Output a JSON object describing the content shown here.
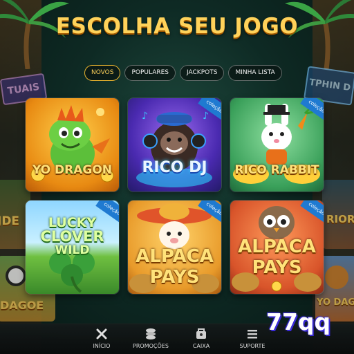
{
  "header": {
    "title": "ESCOLHA SEU JOGO"
  },
  "tabs": [
    {
      "label": "NOVOS",
      "active": true
    },
    {
      "label": "POPULARES",
      "active": false
    },
    {
      "label": "JACKPOTS",
      "active": false
    },
    {
      "label": "MINHA LISTA",
      "active": false
    }
  ],
  "games": [
    {
      "title": "YO DRAGON",
      "badge": ""
    },
    {
      "title": "RICO DJ",
      "badge": "coleção"
    },
    {
      "title": "RICO RABBIT",
      "badge": "coleção"
    },
    {
      "title_lines": [
        "LUCKY",
        "CLOVER",
        "WILD"
      ],
      "badge": "coleção"
    },
    {
      "title_lines": [
        "ALPACA",
        "PAYS"
      ],
      "badge": "coleção"
    },
    {
      "title_lines": [
        "ALPACA",
        "PAYS"
      ],
      "badge": "coleção"
    }
  ],
  "background": {
    "left_sign": "TUAIS",
    "right_sign": "TPHIN D",
    "left_side_text": "JDE",
    "right_side_text": "RIOR",
    "left_bottom_text": "DAGOE",
    "right_bottom_text": "YO DAG"
  },
  "bottom_nav": [
    {
      "label": "INÍCIO",
      "icon": "close-x-icon"
    },
    {
      "label": "PROMOÇÕES",
      "icon": "coins-stack-icon"
    },
    {
      "label": "CAIXA",
      "icon": "wallet-icon"
    },
    {
      "label": "SUPORTE",
      "icon": "menu-lines-icon"
    }
  ],
  "watermark": "77qq",
  "colors": {
    "title_gold": "#ffd25a",
    "tab_active_border": "#e6b12e",
    "badge_blue": "#1f7ad1",
    "watermark_blue": "#3a2bd6"
  }
}
